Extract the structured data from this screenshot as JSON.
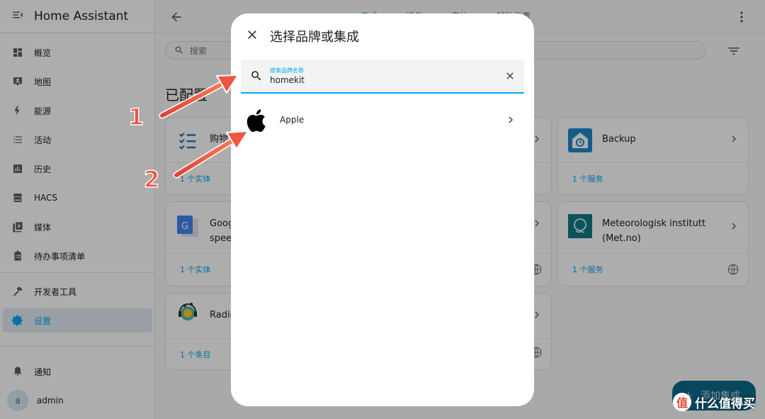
{
  "app": {
    "title": "Home Assistant"
  },
  "sidebar": {
    "items": [
      {
        "label": "概览",
        "icon": "dashboard-icon"
      },
      {
        "label": "地图",
        "icon": "map-person-icon"
      },
      {
        "label": "能源",
        "icon": "lightning-icon"
      },
      {
        "label": "活动",
        "icon": "list-icon"
      },
      {
        "label": "历史",
        "icon": "chart-box-icon"
      },
      {
        "label": "HACS",
        "icon": "hacs-icon"
      },
      {
        "label": "媒体",
        "icon": "play-box-icon"
      },
      {
        "label": "待办事项清单",
        "icon": "clipboard-list-icon"
      }
    ],
    "dev_tools": "开发者工具",
    "settings": "设置",
    "notifications": "通知",
    "user": {
      "name": "admin",
      "initial": "a"
    }
  },
  "topbar": {
    "tabs": [
      "集成",
      "设备",
      "实体",
      "辅助元素"
    ],
    "active_tab": 0
  },
  "search": {
    "placeholder": "搜索"
  },
  "section_title": "已配置",
  "cards": [
    {
      "name": "购物清",
      "link": "1 个实体",
      "logo": "shopping-list-icon"
    },
    {
      "name": "Backup",
      "link": "1 个服务",
      "logo": "backup-icon"
    },
    {
      "name_line1": "Goog",
      "name_line2": "speec",
      "link": "1 个实体",
      "logo": "google-translate-icon"
    },
    {
      "name_line1": "Meteorologisk institutt",
      "name_line2": "(Met.no)",
      "link": "1 个服务",
      "logo": "met-no-icon"
    },
    {
      "name": "Radio",
      "link": "1 个条目",
      "logo": "radio-browser-icon"
    }
  ],
  "dialog": {
    "title": "选择品牌或集成",
    "search_label": "搜索品牌名称",
    "search_value": "homekit",
    "results": [
      {
        "name": "Apple",
        "logo": "apple-icon"
      }
    ]
  },
  "fab": {
    "label": "添加集成"
  },
  "annotations": {
    "step1": "1",
    "step2": "2",
    "color": "#f0553f"
  },
  "watermark": {
    "badge": "值",
    "text": "什么值得买"
  },
  "colors": {
    "accent": "#03a9f4",
    "fab": "#0b6a8d",
    "active_item_bg": "#e3ebf3"
  }
}
